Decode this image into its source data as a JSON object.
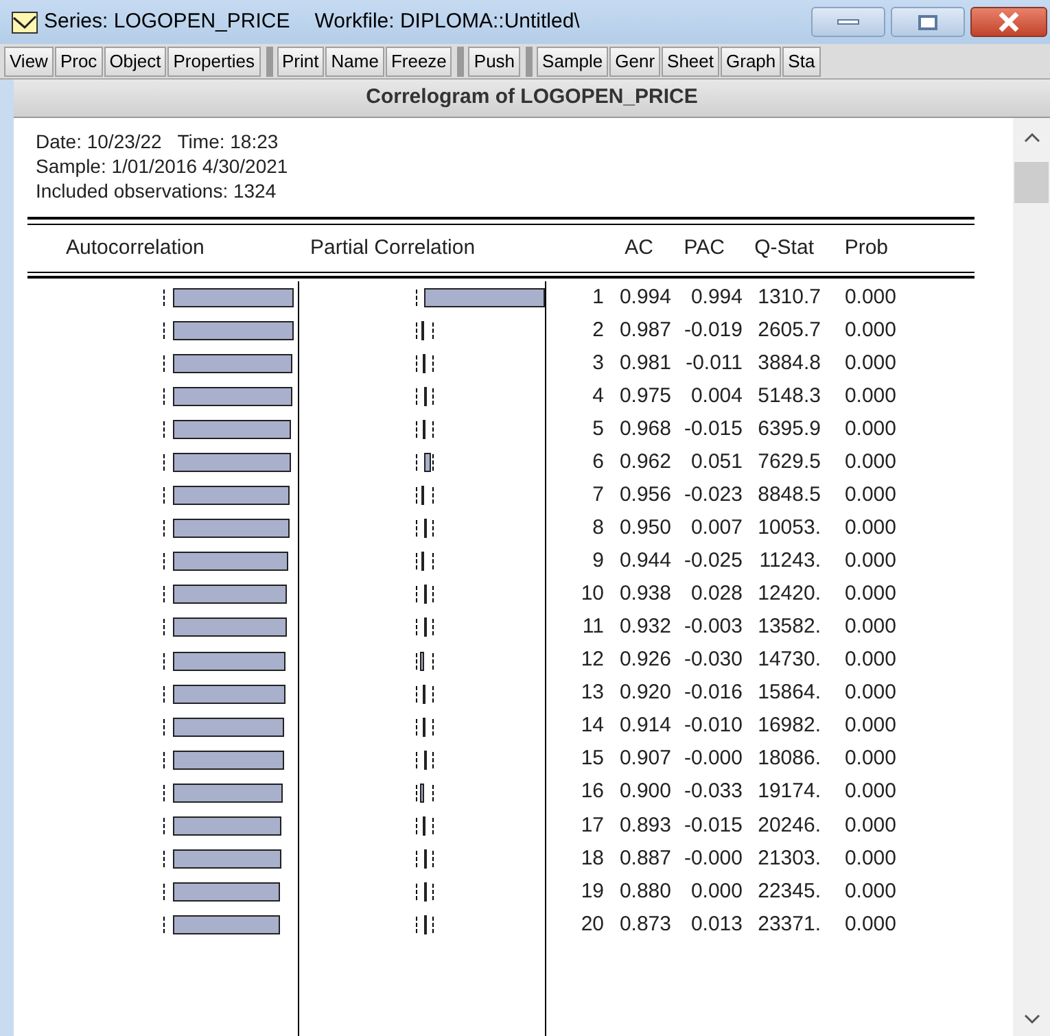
{
  "window": {
    "title": "Series: LOGOPEN_PRICE",
    "workfile": "Workfile: DIPLOMA::Untitled\\"
  },
  "toolbar": [
    {
      "label": "View",
      "group_start": false
    },
    {
      "label": "Proc",
      "group_start": false
    },
    {
      "label": "Object",
      "group_start": false
    },
    {
      "label": "Properties",
      "group_start": false
    },
    {
      "label": "Print",
      "group_start": true
    },
    {
      "label": "Name",
      "group_start": false
    },
    {
      "label": "Freeze",
      "group_start": false
    },
    {
      "label": "Push",
      "group_start": true
    },
    {
      "label": "Sample",
      "group_start": true
    },
    {
      "label": "Genr",
      "group_start": false
    },
    {
      "label": "Sheet",
      "group_start": false
    },
    {
      "label": "Graph",
      "group_start": false
    },
    {
      "label": "Sta",
      "group_start": false
    }
  ],
  "view_title": "Correlogram of LOGOPEN_PRICE",
  "info": [
    "Date: 10/23/22   Time: 18:23",
    "Sample: 1/01/2016 4/30/2021",
    "Included observations: 1324"
  ],
  "columns": [
    "Autocorrelation",
    "Partial Correlation",
    "AC",
    "PAC",
    "Q-Stat",
    "Prob"
  ],
  "rows": [
    {
      "lag": "1",
      "ac": "0.994",
      "pac": "0.994",
      "q": "1310.7",
      "prob": "0.000"
    },
    {
      "lag": "2",
      "ac": "0.987",
      "pac": "-0.019",
      "q": "2605.7",
      "prob": "0.000"
    },
    {
      "lag": "3",
      "ac": "0.981",
      "pac": "-0.011",
      "q": "3884.8",
      "prob": "0.000"
    },
    {
      "lag": "4",
      "ac": "0.975",
      "pac": "0.004",
      "q": "5148.3",
      "prob": "0.000"
    },
    {
      "lag": "5",
      "ac": "0.968",
      "pac": "-0.015",
      "q": "6395.9",
      "prob": "0.000"
    },
    {
      "lag": "6",
      "ac": "0.962",
      "pac": "0.051",
      "q": "7629.5",
      "prob": "0.000"
    },
    {
      "lag": "7",
      "ac": "0.956",
      "pac": "-0.023",
      "q": "8848.5",
      "prob": "0.000"
    },
    {
      "lag": "8",
      "ac": "0.950",
      "pac": "0.007",
      "q": "10053.",
      "prob": "0.000"
    },
    {
      "lag": "9",
      "ac": "0.944",
      "pac": "-0.025",
      "q": "11243.",
      "prob": "0.000"
    },
    {
      "lag": "10",
      "ac": "0.938",
      "pac": "0.028",
      "q": "12420.",
      "prob": "0.000"
    },
    {
      "lag": "11",
      "ac": "0.932",
      "pac": "-0.003",
      "q": "13582.",
      "prob": "0.000"
    },
    {
      "lag": "12",
      "ac": "0.926",
      "pac": "-0.030",
      "q": "14730.",
      "prob": "0.000"
    },
    {
      "lag": "13",
      "ac": "0.920",
      "pac": "-0.016",
      "q": "15864.",
      "prob": "0.000"
    },
    {
      "lag": "14",
      "ac": "0.914",
      "pac": "-0.010",
      "q": "16982.",
      "prob": "0.000"
    },
    {
      "lag": "15",
      "ac": "0.907",
      "pac": "-0.000",
      "q": "18086.",
      "prob": "0.000"
    },
    {
      "lag": "16",
      "ac": "0.900",
      "pac": "-0.033",
      "q": "19174.",
      "prob": "0.000"
    },
    {
      "lag": "17",
      "ac": "0.893",
      "pac": "-0.015",
      "q": "20246.",
      "prob": "0.000"
    },
    {
      "lag": "18",
      "ac": "0.887",
      "pac": "-0.000",
      "q": "21303.",
      "prob": "0.000"
    },
    {
      "lag": "19",
      "ac": "0.880",
      "pac": "0.000",
      "q": "22345.",
      "prob": "0.000"
    },
    {
      "lag": "20",
      "ac": "0.873",
      "pac": "0.013",
      "q": "23371.",
      "prob": "0.000"
    }
  ]
}
